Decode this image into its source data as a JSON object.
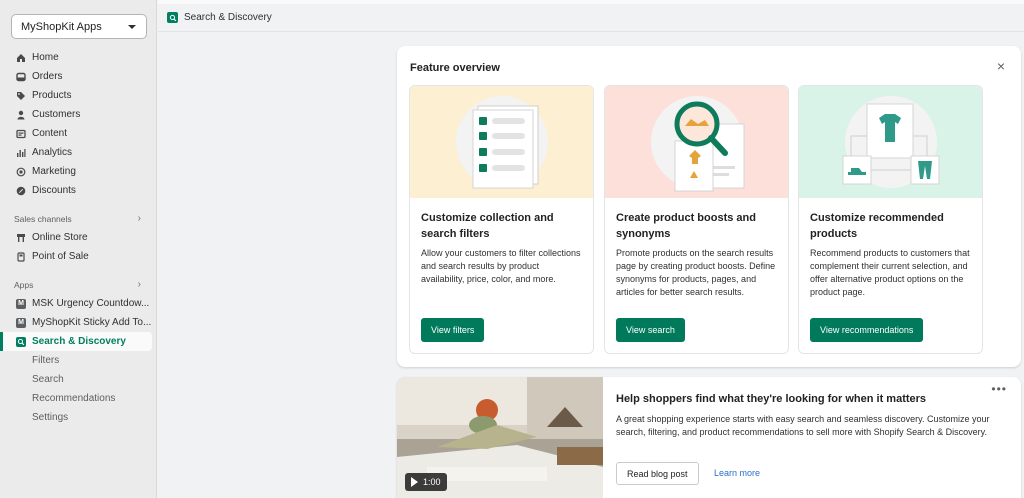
{
  "sidebar": {
    "store_name": "MyShopKit Apps",
    "main_items": [
      {
        "label": "Home",
        "icon": "home-icon"
      },
      {
        "label": "Orders",
        "icon": "orders-icon"
      },
      {
        "label": "Products",
        "icon": "tag-icon"
      },
      {
        "label": "Customers",
        "icon": "person-icon"
      },
      {
        "label": "Content",
        "icon": "content-icon"
      },
      {
        "label": "Analytics",
        "icon": "bar-chart-icon"
      },
      {
        "label": "Marketing",
        "icon": "target-icon"
      },
      {
        "label": "Discounts",
        "icon": "discount-icon"
      }
    ],
    "sales_channels_label": "Sales channels",
    "sales_channels": [
      {
        "label": "Online Store",
        "icon": "store-icon"
      },
      {
        "label": "Point of Sale",
        "icon": "pos-icon"
      }
    ],
    "apps_label": "Apps",
    "apps": [
      {
        "label": "MSK Urgency Countdow...",
        "badge": "M"
      },
      {
        "label": "MyShopKit Sticky Add To...",
        "badge": "M"
      },
      {
        "label": "Search & Discovery",
        "badge": "search-icon"
      }
    ],
    "sub_items": [
      "Filters",
      "Search",
      "Recommendations",
      "Settings"
    ]
  },
  "topbar": {
    "title": "Search & Discovery"
  },
  "feature": {
    "title": "Feature overview",
    "close_label": "×",
    "tiles": [
      {
        "heading": "Customize collection and search filters",
        "text": "Allow your customers to filter collections and search results by product availability, price, color, and more.",
        "button": "View filters",
        "bg": "#fcefd2"
      },
      {
        "heading": "Create product boosts and synonyms",
        "text": "Promote products on the search results page by creating product boosts. Define synonyms for products, pages, and articles for better search results.",
        "button": "View search",
        "bg": "#fde0da"
      },
      {
        "heading": "Customize recommended products",
        "text": "Recommend products to customers that complement their current selection, and offer alternative product options on the product page.",
        "button": "View recommendations",
        "bg": "#d9f3e8"
      }
    ]
  },
  "blog": {
    "heading": "Help shoppers find what they're looking for when it matters",
    "text": "A great shopping experience starts with easy search and seamless discovery. Customize your search, filtering, and product recommendations to sell more with Shopify Search & Discovery.",
    "primary_button": "Read blog post",
    "link": "Learn more",
    "video_duration": "1:00",
    "more_label": "•••"
  },
  "colors": {
    "accent": "#008060",
    "button": "#007a5a",
    "link": "#2c6ecb"
  }
}
